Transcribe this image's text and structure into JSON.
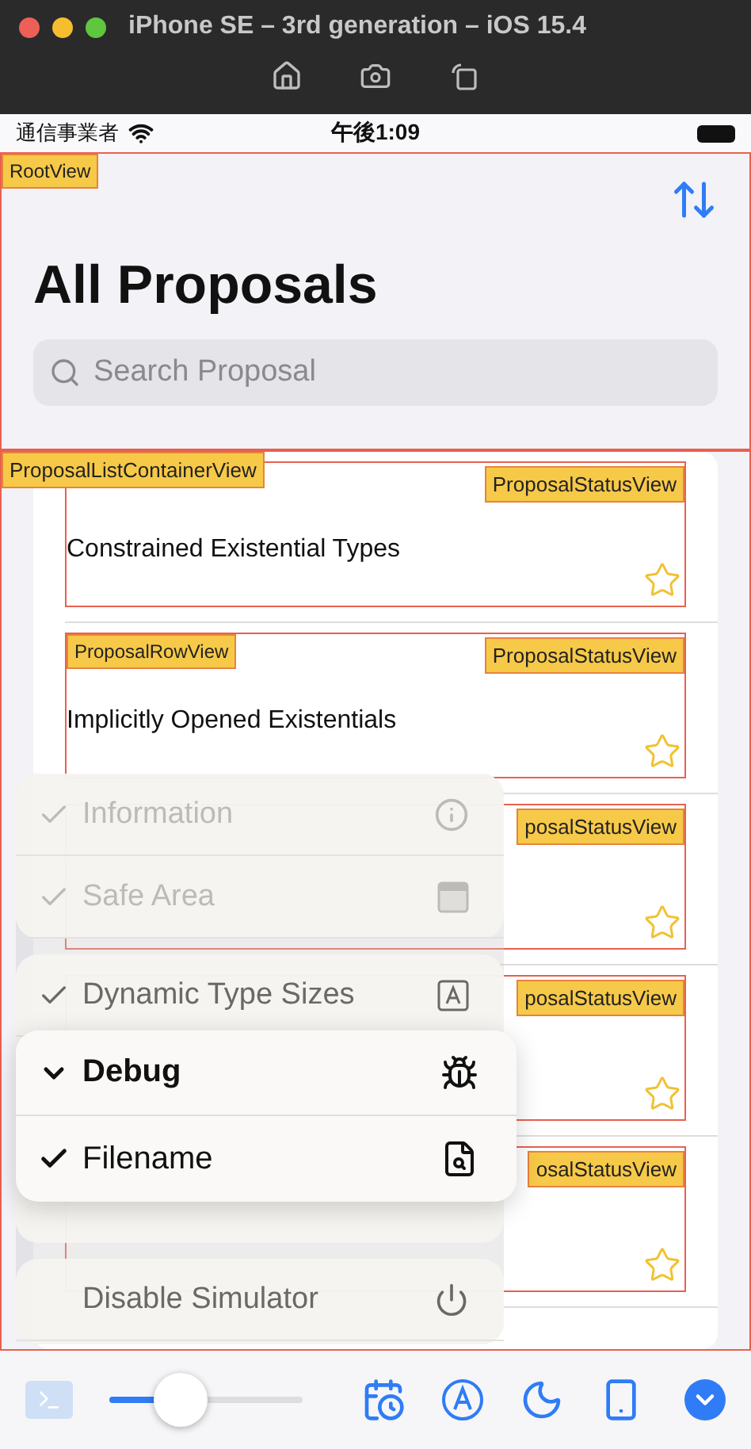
{
  "window": {
    "title": "iPhone SE – 3rd generation – iOS 15.4"
  },
  "status_bar": {
    "carrier": "通信事業者",
    "time": "午後1:09"
  },
  "root_view": {
    "tag": "RootView",
    "title": "All Proposals",
    "search": {
      "placeholder": "Search Proposal"
    }
  },
  "list_container": {
    "tag": "ProposalListContainerView",
    "rows": [
      {
        "status_tag": "ProposalStatusView",
        "title": "Constrained Existential Types"
      },
      {
        "row_tag": "ProposalRowView",
        "status_tag": "ProposalStatusView",
        "title": "Implicitly Opened Existentials"
      },
      {
        "status_tag": "posalStatusView"
      },
      {
        "status_tag": "posalStatusView"
      },
      {
        "status_tag": "osalStatusView"
      }
    ]
  },
  "menu": {
    "groups": [
      [
        {
          "label": "Information",
          "checked": true,
          "disabled": true,
          "kind": "info"
        },
        {
          "label": "Safe Area",
          "checked": true,
          "disabled": true,
          "kind": "safearea"
        }
      ],
      [
        {
          "label": "Dynamic Type Sizes",
          "checked": true,
          "disabled": false,
          "kind": "typesize"
        }
      ],
      [
        {
          "label": "Disable Simulator",
          "checked": false,
          "disabled": false,
          "kind": "power"
        }
      ]
    ],
    "submenu": {
      "title": "Debug",
      "expanded": true,
      "items": [
        {
          "label": "Filename",
          "checked": true,
          "kind": "filesearch"
        }
      ]
    }
  },
  "toolbar": {
    "slider": {
      "level": 0.37
    }
  }
}
